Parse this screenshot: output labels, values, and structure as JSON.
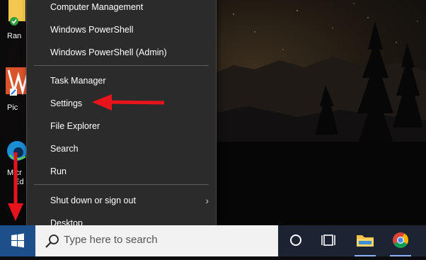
{
  "desktop": {
    "icons": [
      {
        "label": "Ran"
      },
      {
        "label": "Pic"
      },
      {
        "label": "Micr"
      },
      {
        "label": "Ed"
      }
    ]
  },
  "menu": {
    "items": [
      {
        "label": "Computer Management"
      },
      {
        "label": "Windows PowerShell"
      },
      {
        "label": "Windows PowerShell (Admin)"
      },
      {
        "label": "Task Manager"
      },
      {
        "label": "Settings"
      },
      {
        "label": "File Explorer"
      },
      {
        "label": "Search"
      },
      {
        "label": "Run"
      },
      {
        "label": "Shut down or sign out"
      },
      {
        "label": "Desktop"
      }
    ],
    "submenu_glyph": "›"
  },
  "taskbar": {
    "search_placeholder": "Type here to search",
    "icons": [
      "windows-icon",
      "search-icon",
      "cortana-icon",
      "task-view-icon",
      "file-explorer-icon",
      "chrome-icon"
    ]
  },
  "annotations": {
    "arrow_color": "#e8141b"
  }
}
